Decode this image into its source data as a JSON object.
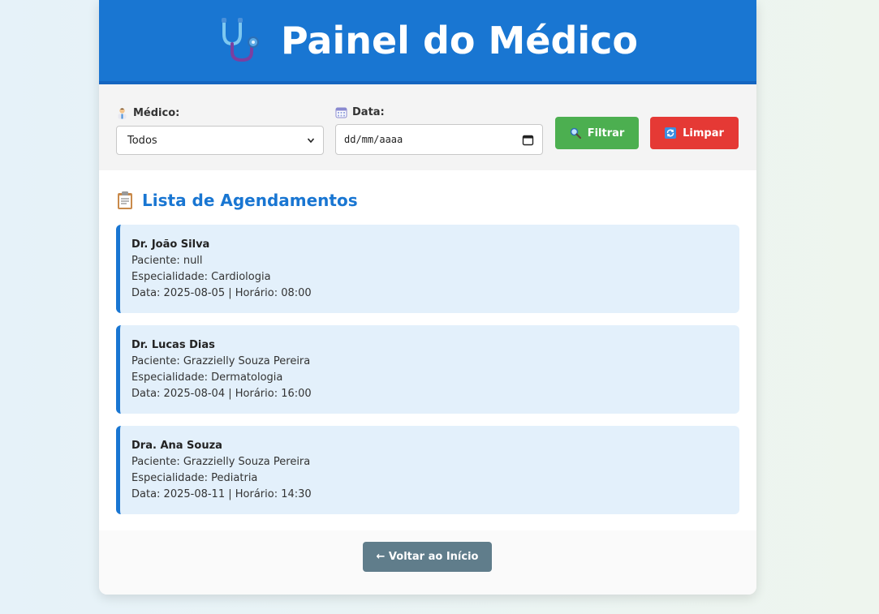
{
  "header": {
    "icon": "stethoscope-icon",
    "title": "Painel do Médico"
  },
  "filters": {
    "doctor_label": "Médico:",
    "doctor_icon": "doctor-icon",
    "doctor_selected": "Todos",
    "date_label": "Data:",
    "date_icon": "calendar-icon",
    "date_placeholder": "dd/mm/aaaa",
    "filter_button": "Filtrar",
    "filter_icon": "search-icon",
    "clear_button": "Limpar",
    "clear_icon": "refresh-icon"
  },
  "appointments": {
    "icon": "clipboard-icon",
    "title": "Lista de Agendamentos",
    "items": [
      {
        "doctor": "Dr. João Silva",
        "patient": "Paciente: null",
        "specialty": "Especialidade: Cardiologia",
        "datetime": "Data: 2025-08-05 | Horário: 08:00"
      },
      {
        "doctor": "Dr. Lucas Dias",
        "patient": "Paciente: Grazzielly Souza Pereira",
        "specialty": "Especialidade: Dermatologia",
        "datetime": "Data: 2025-08-04 | Horário: 16:00"
      },
      {
        "doctor": "Dra. Ana Souza",
        "patient": "Paciente: Grazzielly Souza Pereira",
        "specialty": "Especialidade: Pediatria",
        "datetime": "Data: 2025-08-11 | Horário: 14:30"
      }
    ]
  },
  "footer": {
    "back_button": "← Voltar ao Início"
  },
  "colors": {
    "header": "#1976d2",
    "filter_button": "#4caf50",
    "clear_button": "#e53935",
    "back_button": "#607d8b",
    "card_background": "#e3f0fb"
  }
}
